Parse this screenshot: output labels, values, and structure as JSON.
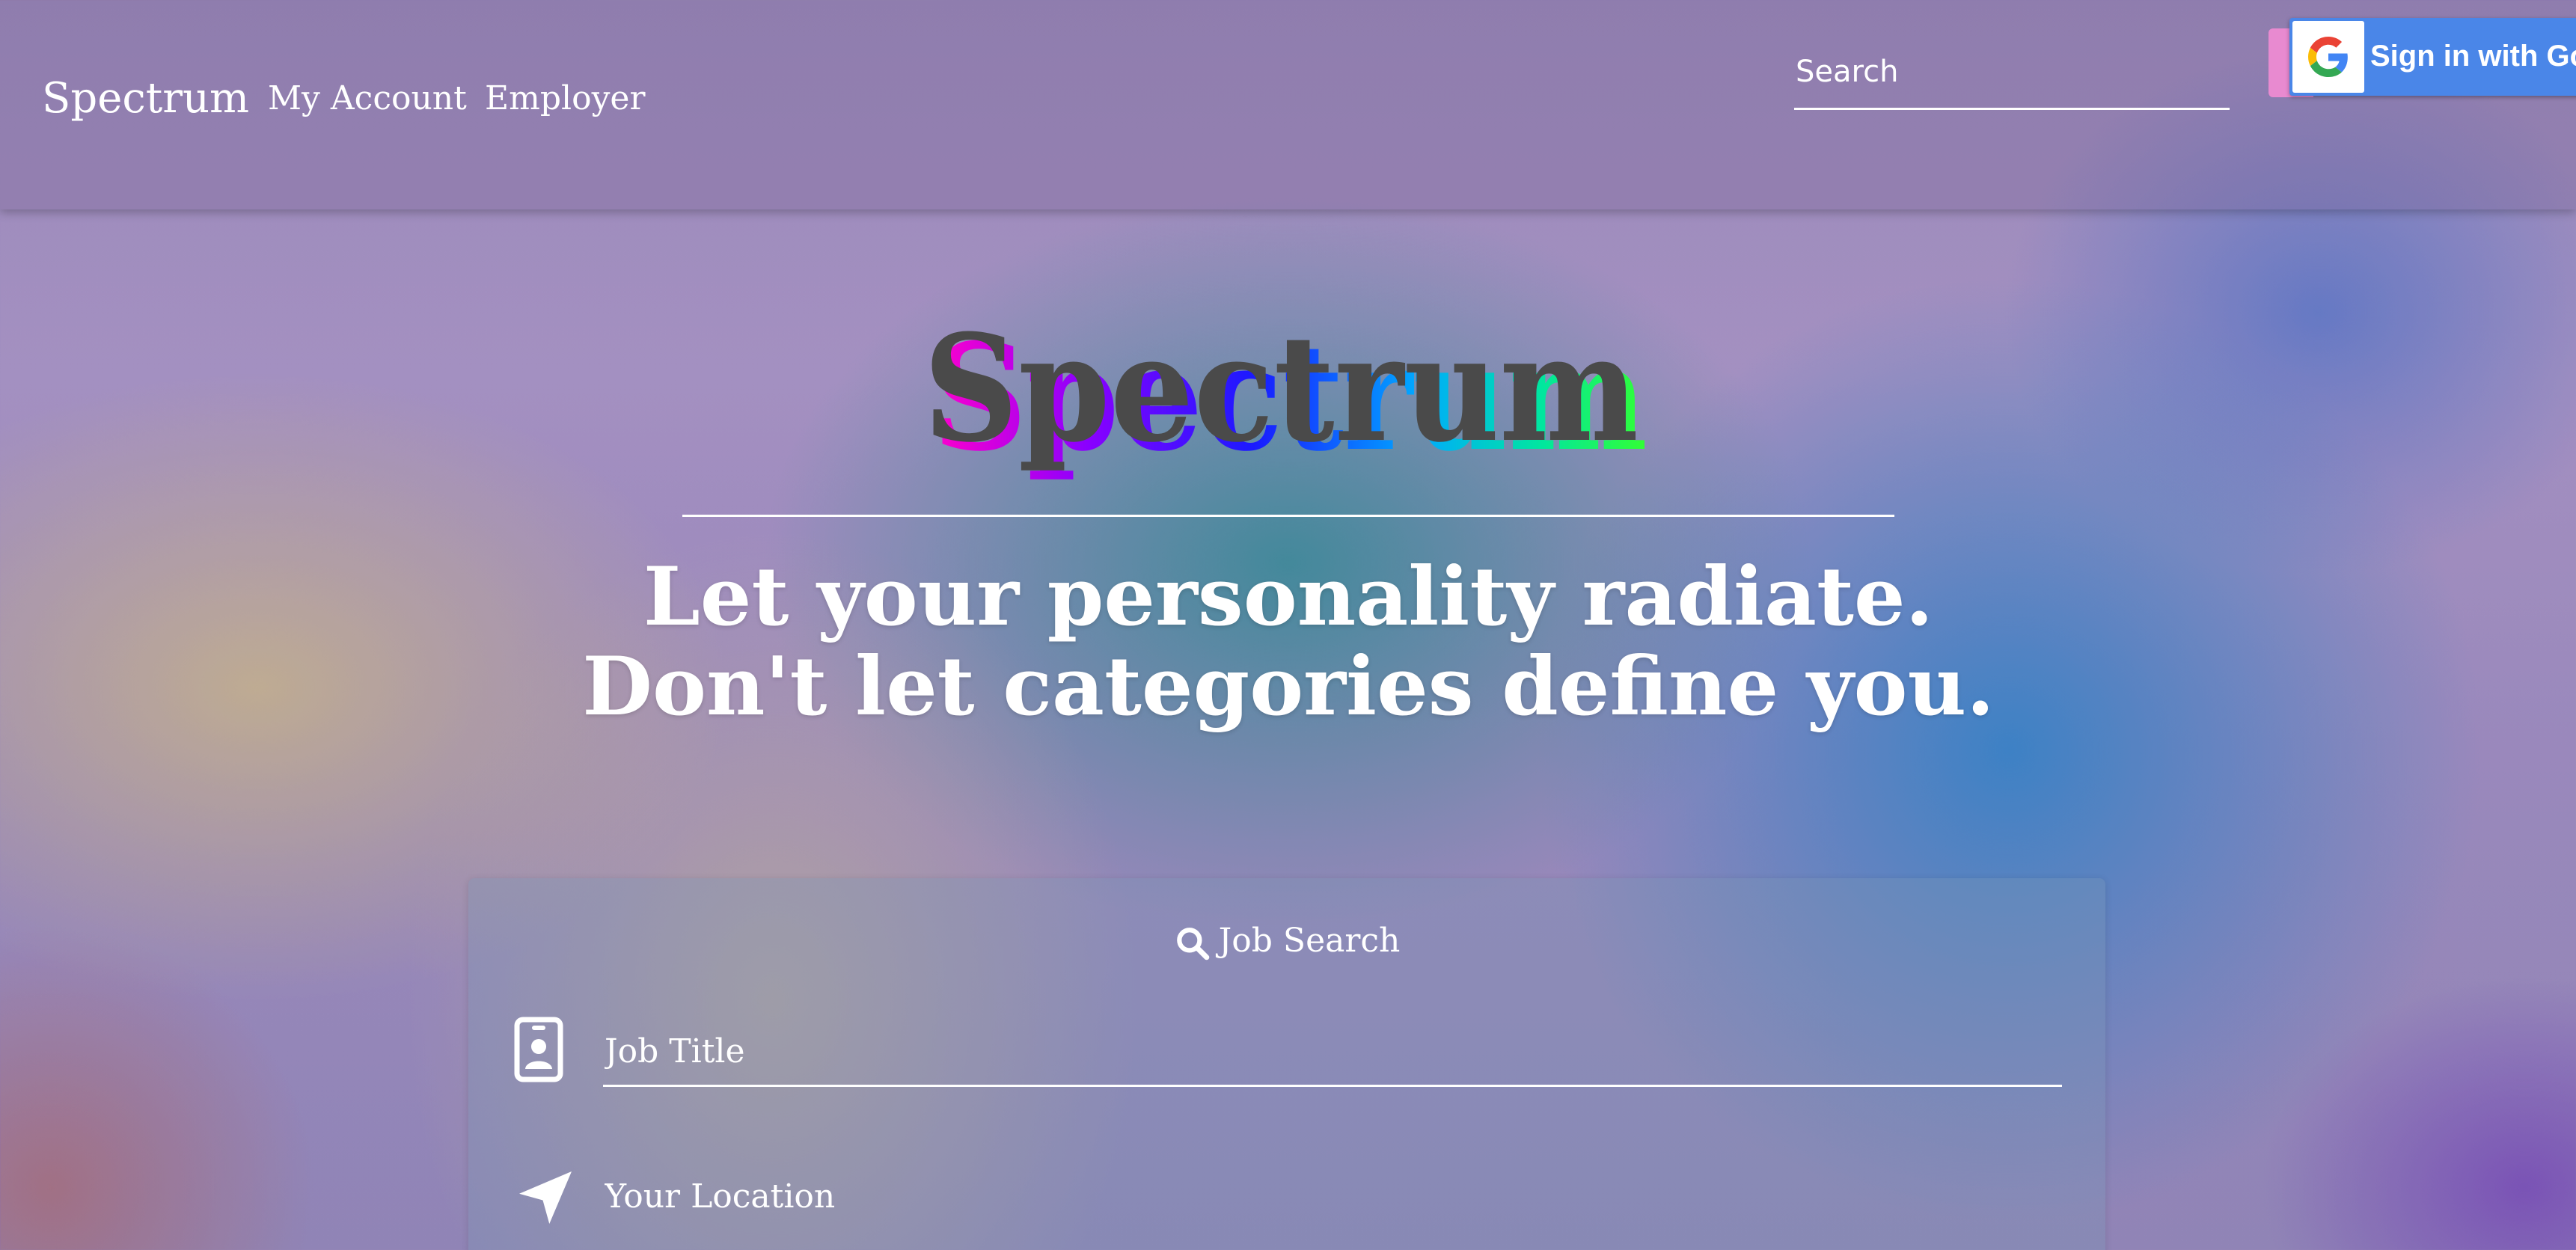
{
  "nav": {
    "brand": "Spectrum",
    "links": [
      {
        "label": "My Account"
      },
      {
        "label": "Employer"
      }
    ],
    "search_placeholder": "Search",
    "google_button_label": "Sign in with Google"
  },
  "hero": {
    "logo_text": "Spectrum",
    "tagline_line1": "Let your personality radiate.",
    "tagline_line2": "Don't let categories define you."
  },
  "job_search": {
    "title": "Job Search",
    "job_title_placeholder": "Job Title",
    "location_placeholder": "Your Location"
  },
  "colors": {
    "logo_text": "#4a4a4a",
    "logo_gradient": [
      "#ff00cc",
      "#8800ff",
      "#1a1aff",
      "#00aaff",
      "#00e676",
      "#33ff33"
    ],
    "google_blue": "#4a86e8",
    "pink_accent": "#e88ad0"
  },
  "icons": {
    "job_search": "search-icon",
    "job_title": "id-badge-icon",
    "location": "location-arrow-icon",
    "google": "google-g-icon"
  }
}
